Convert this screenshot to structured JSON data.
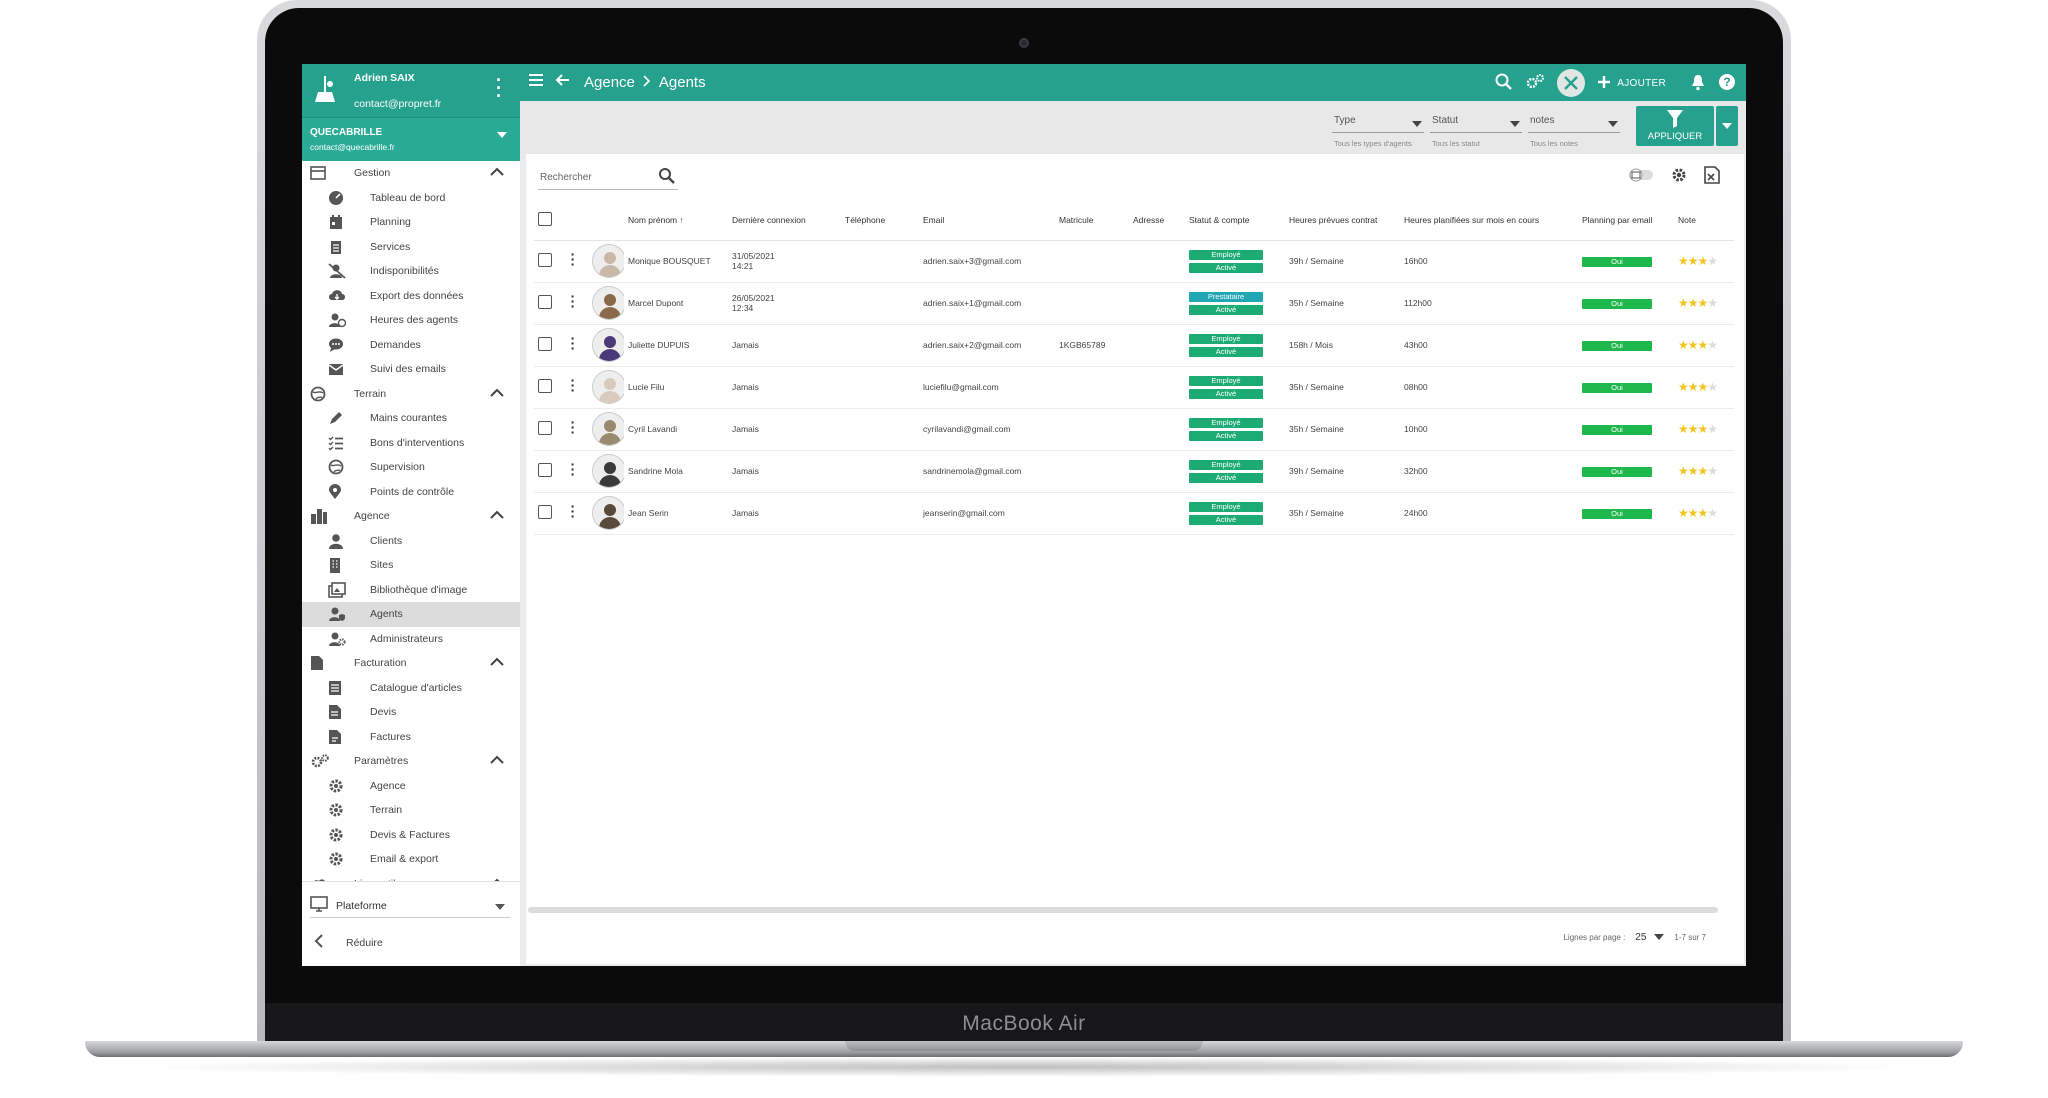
{
  "device": {
    "brand": "MacBook Air"
  },
  "sidebar": {
    "user": {
      "name": "Adrien SAIX",
      "email": "contact@propret.fr"
    },
    "company": {
      "name": "QUECABRILLE",
      "email": "contact@quecabrille.fr"
    },
    "groups": [
      {
        "label": "Gestion",
        "icon": "gauge-icon",
        "items": [
          {
            "label": "Tableau de bord",
            "icon": "dashboard-icon"
          },
          {
            "label": "Planning",
            "icon": "calendar-icon"
          },
          {
            "label": "Services",
            "icon": "services-icon"
          },
          {
            "label": "Indisponibilités",
            "icon": "user-off-icon"
          },
          {
            "label": "Export des données",
            "icon": "cloud-download-icon"
          },
          {
            "label": "Heures des agents",
            "icon": "user-clock-icon"
          },
          {
            "label": "Demandes",
            "icon": "chat-icon"
          },
          {
            "label": "Suivi des emails",
            "icon": "mail-icon"
          }
        ]
      },
      {
        "label": "Terrain",
        "icon": "globe-icon",
        "items": [
          {
            "label": "Mains courantes",
            "icon": "pen-icon"
          },
          {
            "label": "Bons d'interventions",
            "icon": "checklist-icon"
          },
          {
            "label": "Supervision",
            "icon": "globe-icon"
          },
          {
            "label": "Points de contrôle",
            "icon": "pin-icon"
          }
        ]
      },
      {
        "label": "Agence",
        "icon": "city-icon",
        "items": [
          {
            "label": "Clients",
            "icon": "user-icon"
          },
          {
            "label": "Sites",
            "icon": "building-icon"
          },
          {
            "label": "Bibliothèque d'image",
            "icon": "images-icon"
          },
          {
            "label": "Agents",
            "icon": "user-shield-icon",
            "active": true
          },
          {
            "label": "Administrateurs",
            "icon": "user-gear-icon"
          }
        ]
      },
      {
        "label": "Facturation",
        "icon": "file-icon",
        "items": [
          {
            "label": "Catalogue d'articles",
            "icon": "catalog-icon"
          },
          {
            "label": "Devis",
            "icon": "doc-icon"
          },
          {
            "label": "Factures",
            "icon": "invoice-icon"
          }
        ]
      },
      {
        "label": "Paramètres",
        "icon": "gears-icon",
        "items": [
          {
            "label": "Agence",
            "icon": "gear-icon"
          },
          {
            "label": "Terrain",
            "icon": "gear-icon"
          },
          {
            "label": "Devis & Factures",
            "icon": "gear-icon"
          },
          {
            "label": "Email & export",
            "icon": "gear-icon"
          }
        ]
      },
      {
        "label": "Liens utiles",
        "icon": "link-icon",
        "items": []
      }
    ],
    "platform": {
      "label": "Plateforme"
    },
    "reduce": {
      "label": "Réduire"
    }
  },
  "topbar": {
    "breadcrumb": [
      "Agence",
      "Agents"
    ],
    "add_label": "AJOUTER"
  },
  "filters": [
    {
      "value": "Type",
      "hint": "Tous les types d'agents"
    },
    {
      "value": "Statut",
      "hint": "Tous les statut"
    },
    {
      "value": "notes",
      "hint": "Tous les notes"
    }
  ],
  "apply_label": "APPLIQUER",
  "search": {
    "placeholder": "Rechercher"
  },
  "table": {
    "columns": [
      "Nom prénom",
      "Dernière connexion",
      "Téléphone",
      "Email",
      "Matricule",
      "Adresse",
      "Statut & compte",
      "Heures prévues contrat",
      "Heures planifiées sur mois en cours",
      "Planning par email",
      "Note"
    ],
    "rows": [
      {
        "name": "Monique BOUSQUET",
        "last_login": "31/05/2021",
        "last_login_time": "14:21",
        "phone": "",
        "email": "adrien.saix+3@gmail.com",
        "matricule": "",
        "address": "",
        "status": "Employé",
        "account": "Activé",
        "contract": "39h / Semaine",
        "planned": "16h00",
        "planning_email": "Oui",
        "rating": 3,
        "avatar_color": "#c9b8a6"
      },
      {
        "name": "Marcel Dupont",
        "last_login": "26/05/2021",
        "last_login_time": "12:34",
        "phone": "",
        "email": "adrien.saix+1@gmail.com",
        "matricule": "",
        "address": "",
        "status": "Prestataire",
        "account": "Activé",
        "contract": "35h / Semaine",
        "planned": "112h00",
        "planning_email": "Oui",
        "rating": 3,
        "avatar_color": "#8a6a4a"
      },
      {
        "name": "Juliette DUPUIS",
        "last_login": "Jamais",
        "last_login_time": "",
        "phone": "",
        "email": "adrien.saix+2@gmail.com",
        "matricule": "1KGB65789",
        "address": "",
        "status": "Employé",
        "account": "Activé",
        "contract": "158h / Mois",
        "planned": "43h00",
        "planning_email": "Oui",
        "rating": 3,
        "avatar_color": "#4b3a7a"
      },
      {
        "name": "Lucie Filu",
        "last_login": "Jamais",
        "last_login_time": "",
        "phone": "",
        "email": "luciefilu@gmail.com",
        "matricule": "",
        "address": "",
        "status": "Employé",
        "account": "Activé",
        "contract": "35h / Semaine",
        "planned": "08h00",
        "planning_email": "Oui",
        "rating": 3,
        "avatar_color": "#d8cbbd"
      },
      {
        "name": "Cyril Lavandi",
        "last_login": "Jamais",
        "last_login_time": "",
        "phone": "",
        "email": "cyrilavandi@gmail.com",
        "matricule": "",
        "address": "",
        "status": "Employé",
        "account": "Activé",
        "contract": "35h / Semaine",
        "planned": "10h00",
        "planning_email": "Oui",
        "rating": 3,
        "avatar_color": "#9a8a70"
      },
      {
        "name": "Sandrine Mola",
        "last_login": "Jamais",
        "last_login_time": "",
        "phone": "",
        "email": "sandrinemola@gmail.com",
        "matricule": "",
        "address": "",
        "status": "Employé",
        "account": "Activé",
        "contract": "39h / Semaine",
        "planned": "32h00",
        "planning_email": "Oui",
        "rating": 3,
        "avatar_color": "#3a3a3a"
      },
      {
        "name": "Jean Serin",
        "last_login": "Jamais",
        "last_login_time": "",
        "phone": "",
        "email": "jeanserin@gmail.com",
        "matricule": "",
        "address": "",
        "status": "Employé",
        "account": "Activé",
        "contract": "35h / Semaine",
        "planned": "24h00",
        "planning_email": "Oui",
        "rating": 3,
        "avatar_color": "#5a4a3a"
      }
    ]
  },
  "pagination": {
    "rows_label": "Lignes par page :",
    "per_page": "25",
    "range": "1-7 sur 7"
  },
  "colors": {
    "primary": "#25a18e",
    "tag_employe": "#1dab74",
    "tag_presta": "#21a6b3",
    "oui": "#1fb84c",
    "star": "#f2c51e"
  }
}
